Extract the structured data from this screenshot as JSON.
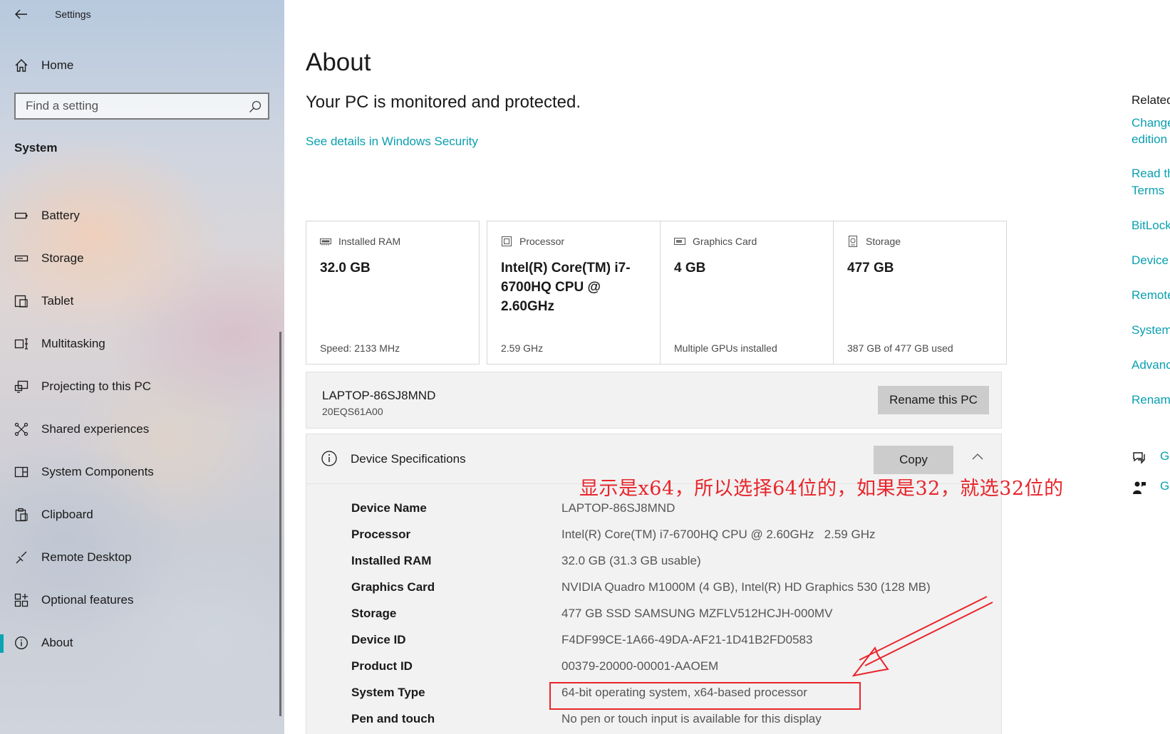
{
  "app": {
    "title": "Settings"
  },
  "sidebar": {
    "home_label": "Home",
    "search_placeholder": "Find a setting",
    "section": "System",
    "items": [
      {
        "label": "Battery",
        "icon": "battery-icon"
      },
      {
        "label": "Storage",
        "icon": "storage-icon"
      },
      {
        "label": "Tablet",
        "icon": "tablet-icon"
      },
      {
        "label": "Multitasking",
        "icon": "multitasking-icon"
      },
      {
        "label": "Projecting to this PC",
        "icon": "projecting-icon"
      },
      {
        "label": "Shared experiences",
        "icon": "shared-experiences-icon"
      },
      {
        "label": "System Components",
        "icon": "system-components-icon"
      },
      {
        "label": "Clipboard",
        "icon": "clipboard-icon"
      },
      {
        "label": "Remote Desktop",
        "icon": "remote-desktop-icon"
      },
      {
        "label": "Optional features",
        "icon": "optional-features-icon"
      },
      {
        "label": "About",
        "icon": "info-icon",
        "selected": true
      }
    ]
  },
  "main": {
    "title": "About",
    "protection": "Your PC is monitored and protected.",
    "security_link": "See details in Windows Security",
    "cards": [
      {
        "label": "Installed RAM",
        "value": "32.0 GB",
        "footer": "Speed: 2133 MHz",
        "icon": "ram-icon"
      },
      {
        "label": "Processor",
        "value": "Intel(R) Core(TM) i7-6700HQ CPU @ 2.60GHz",
        "footer": "2.59 GHz",
        "icon": "processor-icon"
      },
      {
        "label": "Graphics Card",
        "value": "4 GB",
        "footer": "Multiple GPUs installed",
        "icon": "graphics-card-icon"
      },
      {
        "label": "Storage",
        "value": "477 GB",
        "footer": "387 GB of 477 GB used",
        "icon": "storage-drive-icon"
      }
    ],
    "pc": {
      "name": "LAPTOP-86SJ8MND",
      "model": "20EQS61A00",
      "rename_label": "Rename this PC"
    },
    "specs": {
      "title": "Device Specifications",
      "copy_label": "Copy",
      "rows": [
        {
          "label": "Device Name",
          "value": "LAPTOP-86SJ8MND"
        },
        {
          "label": "Processor",
          "value": "Intel(R) Core(TM) i7-6700HQ CPU @ 2.60GHz   2.59 GHz"
        },
        {
          "label": "Installed RAM",
          "value": "32.0 GB (31.3 GB usable)"
        },
        {
          "label": "Graphics Card",
          "value": "NVIDIA Quadro M1000M (4 GB), Intel(R) HD Graphics 530 (128 MB)"
        },
        {
          "label": "Storage",
          "value": "477 GB SSD SAMSUNG MZFLV512HCJH-000MV"
        },
        {
          "label": "Device ID",
          "value": "F4DF99CE-1A66-49DA-AF21-1D41B2FD0583"
        },
        {
          "label": "Product ID",
          "value": "00379-20000-00001-AAOEM"
        },
        {
          "label": "System Type",
          "value": "64-bit operating system, x64-based processor"
        },
        {
          "label": "Pen and touch",
          "value": "No pen or touch input is available for this display"
        }
      ]
    }
  },
  "annotation": {
    "text": "显示是x64，所以选择64位的，如果是32，就选32位的",
    "color": "#e8252b"
  },
  "related": {
    "title": "Related",
    "links": [
      "Change",
      "edition",
      "Read th",
      "Terms",
      "BitLock",
      "Device",
      "Remote",
      "System",
      "Advanc",
      "Renam"
    ],
    "help": [
      "G",
      "G"
    ]
  },
  "colors": {
    "accent": "#0a9fb0",
    "panel": "#f2f2f2",
    "button": "#cccccc"
  }
}
